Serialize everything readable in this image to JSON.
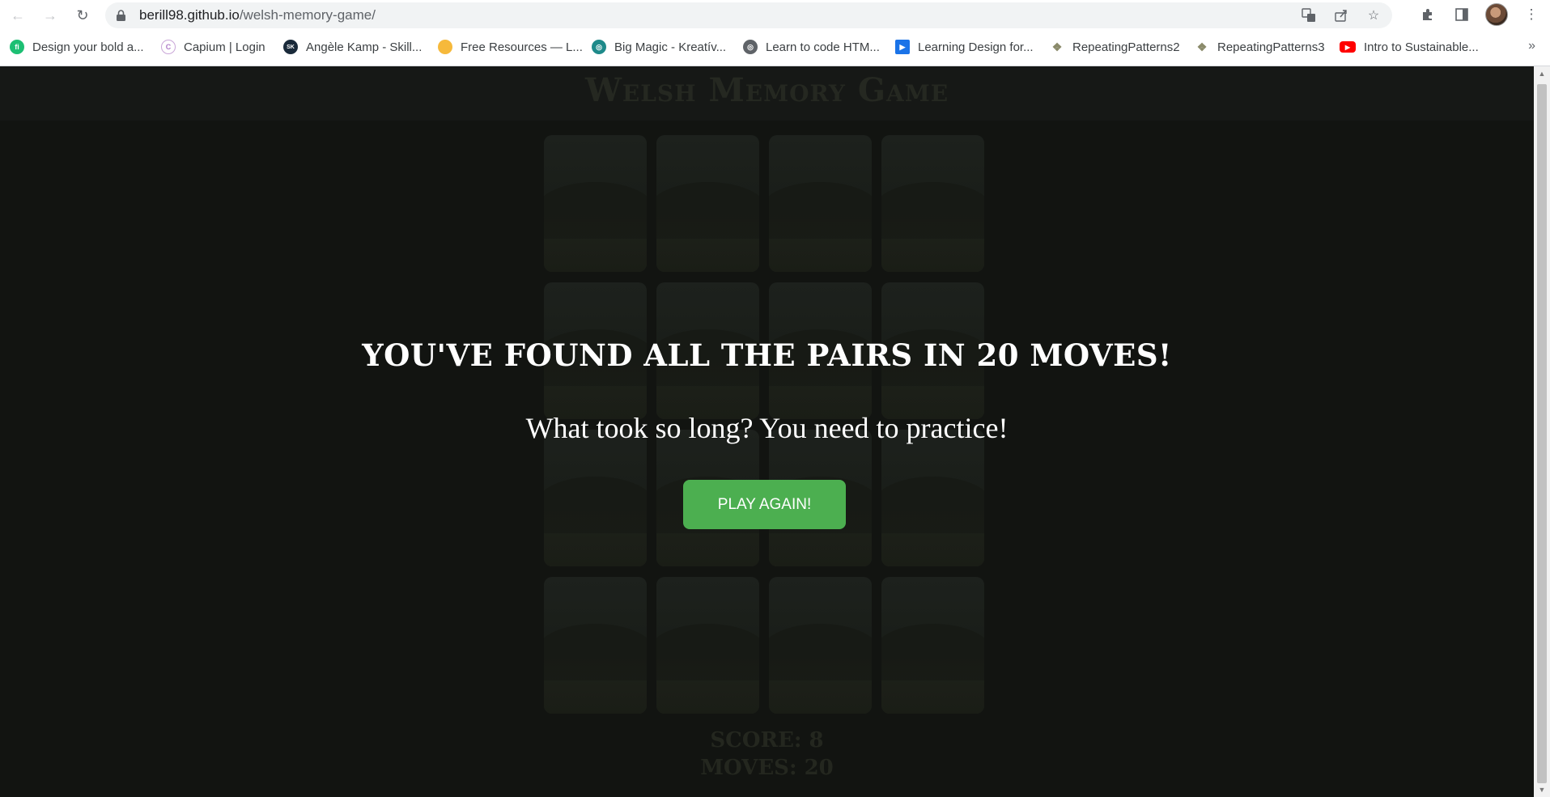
{
  "browser": {
    "url_host": "berill98.github.io",
    "url_path": "/welsh-memory-game/",
    "bookmarks": [
      {
        "label": "Design your bold a...",
        "icon": "fiverr-icon",
        "color": "#1dbf73",
        "glyph": "fi"
      },
      {
        "label": "Capium | Login",
        "icon": "capium-icon",
        "color": "#c9a6d8",
        "glyph": "C"
      },
      {
        "label": "Angèle Kamp - Skill...",
        "icon": "skillshare-icon",
        "color": "#1a2a3a",
        "glyph": "SK"
      },
      {
        "label": "Free Resources — L...",
        "icon": "resources-icon",
        "color": "#f6b93b",
        "glyph": ""
      },
      {
        "label": "Big Magic - Kreatív...",
        "icon": "globe-teal-icon",
        "color": "#1e8a8a",
        "glyph": ""
      },
      {
        "label": "Learn to code HTM...",
        "icon": "globe-icon",
        "color": "#5f6368",
        "glyph": ""
      },
      {
        "label": "Learning Design for...",
        "icon": "video-icon",
        "color": "#1a73e8",
        "glyph": "▶"
      },
      {
        "label": "RepeatingPatterns2",
        "icon": "pattern-icon",
        "color": "#8a8a6a",
        "glyph": ""
      },
      {
        "label": "RepeatingPatterns3",
        "icon": "pattern-icon",
        "color": "#8a8a6a",
        "glyph": ""
      },
      {
        "label": "Intro to Sustainable...",
        "icon": "youtube-icon",
        "color": "#ff0000",
        "glyph": "▶"
      }
    ]
  },
  "game": {
    "title": "Welsh Memory Game",
    "score_label": "SCORE: 8",
    "moves_label": "MOVES: 20",
    "card_count": 16
  },
  "win_modal": {
    "title": "YOU'VE FOUND ALL THE PAIRS IN 20 MOVES!",
    "subtitle": "What took so long? You need to practice!",
    "button_label": "PLAY AGAIN!",
    "button_color": "#4caf50"
  }
}
